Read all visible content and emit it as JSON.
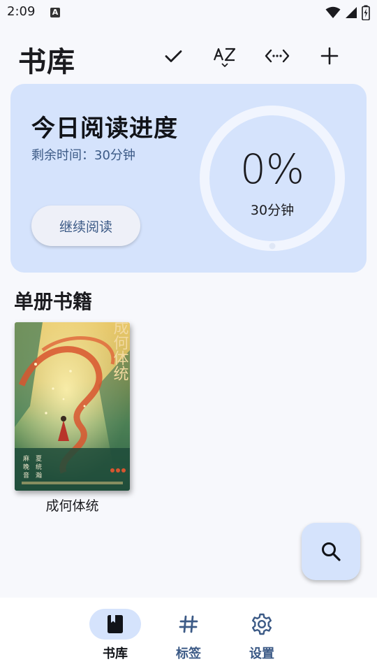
{
  "status_bar": {
    "time": "2:09",
    "notification_icon": "a-icon",
    "wifi_icon": "wifi-icon",
    "signal_icon": "signal-icon",
    "battery_icon": "battery-charging-icon"
  },
  "header": {
    "title": "书库",
    "actions": [
      {
        "icon": "check-icon"
      },
      {
        "icon": "sort-az-icon"
      },
      {
        "icon": "expand-horizontal-icon"
      },
      {
        "icon": "add-icon"
      }
    ]
  },
  "progress_card": {
    "title": "今日阅读进度",
    "remaining_label": "剩余时间：",
    "remaining_value": "30分钟",
    "continue_button": "继续阅读",
    "percent_text": "0%",
    "progress_fraction": 0,
    "goal_text": "30分钟"
  },
  "section": {
    "title": "单册书籍"
  },
  "books": [
    {
      "title": "成何体统",
      "cover_title": "成何体统",
      "cover_authors": [
        "麻",
        "晚",
        "音",
        "夏",
        "统",
        "瀚"
      ]
    }
  ],
  "fab": {
    "icon": "search-icon"
  },
  "bottom_nav": {
    "items": [
      {
        "label": "书库",
        "icon": "book-icon",
        "active": true
      },
      {
        "label": "标签",
        "icon": "hash-icon",
        "active": false
      },
      {
        "label": "设置",
        "icon": "gear-icon",
        "active": false
      }
    ]
  },
  "colors": {
    "background": "#f7f8fc",
    "card": "#d5e3fc",
    "accent_text": "#3c5a86",
    "ring_track": "#f1f5fe"
  }
}
